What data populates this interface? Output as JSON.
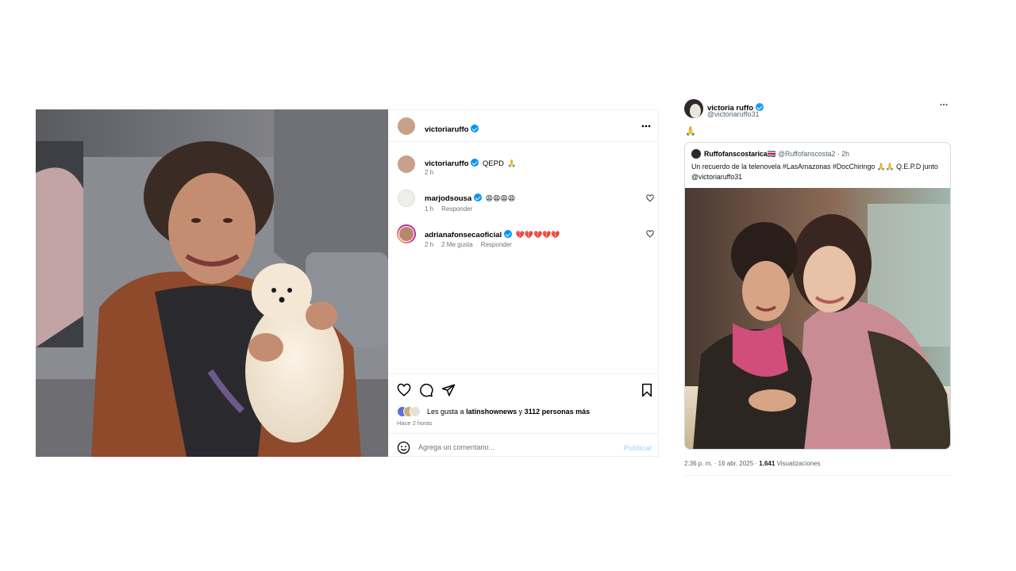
{
  "instagram": {
    "header": {
      "username": "victoriaruffo"
    },
    "caption": {
      "username": "victoriaruffo",
      "text": "QEPD",
      "emoji": "🙏",
      "time": "2 h"
    },
    "comments": [
      {
        "username": "marjodsousa",
        "text": "😩😩😩😩",
        "time": "1 h",
        "likes": "",
        "reply": "Responder"
      },
      {
        "username": "adrianafonsecaoficial",
        "text": "💔💔💔💔💔",
        "time": "2 h",
        "likes": "2 Me gusta",
        "reply": "Responder"
      }
    ],
    "likes": {
      "prefix": "Les gusta a",
      "user": "latinshownews",
      "joiner": "y",
      "count": "3112 personas más"
    },
    "posted": "Hace 2 horas",
    "comment_box": {
      "placeholder": "Agrega un comentario...",
      "publish": "Publicar"
    },
    "icons": [
      "heart-icon",
      "comment-icon",
      "share-icon",
      "bookmark-icon",
      "more-icon",
      "emoji-icon"
    ]
  },
  "tweet": {
    "name": "victoria ruffo",
    "handle": "@victoriaruffo31",
    "text": "🙏",
    "quote": {
      "name": "Ruffofanscostarica🇨🇷",
      "handle": "@Ruffofanscosta2",
      "time": "· 2h",
      "text": "Un recuerdo  de la telenovela #LasAmazonas #DocChiringo 🙏🙏 Q.E.P.D junto @victoriaruffo31"
    },
    "footer": {
      "time": "2:36 p. m. · 16 abr. 2025 ·",
      "views": "1.641",
      "views_label": "Visualizaciones"
    }
  },
  "colors": {
    "verified": "#0095f6",
    "publish_disabled": "#b2dffc",
    "secondary_text": "#737373"
  }
}
